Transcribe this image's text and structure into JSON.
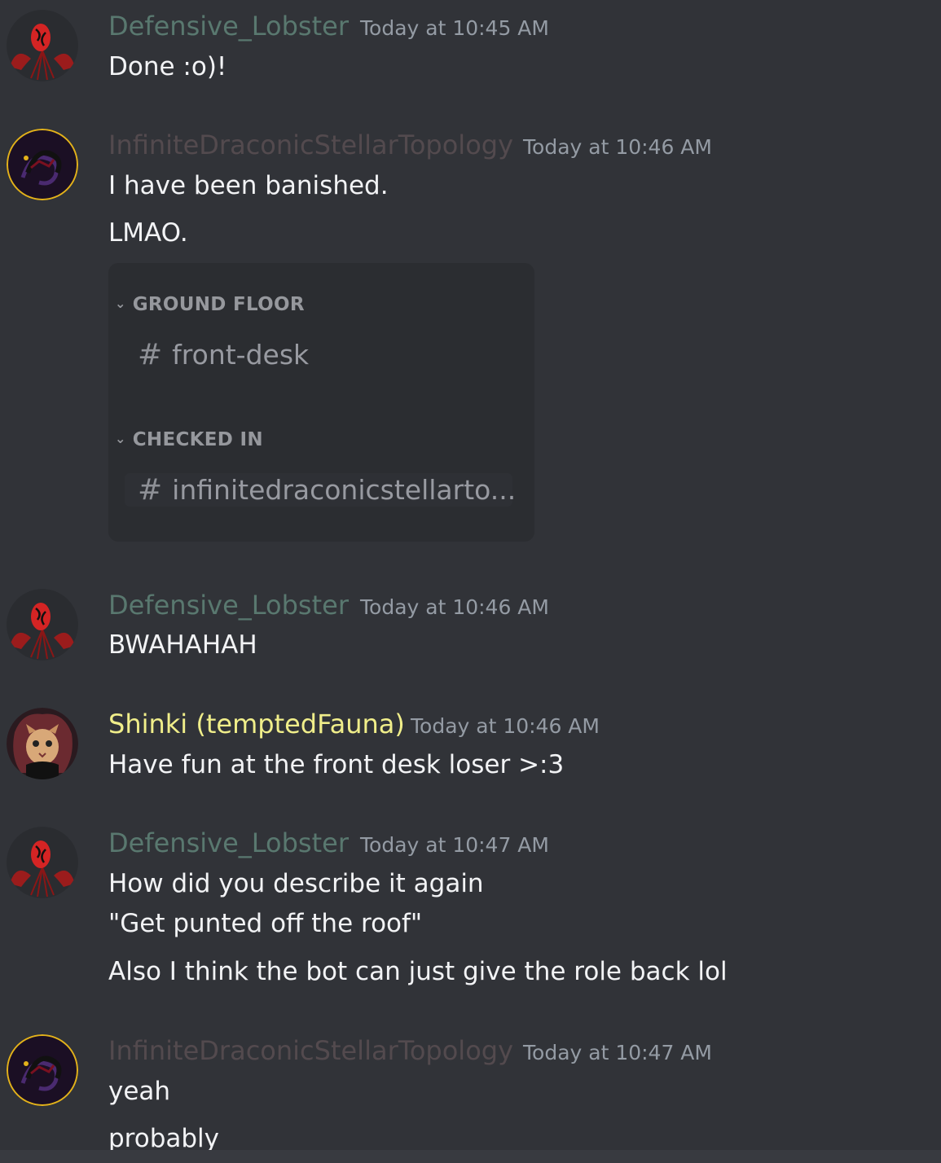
{
  "messages": [
    {
      "author": "Defensive_Lobster",
      "author_color": "#59786f",
      "time": "Today at 10:45 AM",
      "lines": [
        "Done :o)!"
      ]
    },
    {
      "author": "InfiniteDraconicStellarTopology",
      "author_color": "#534a4e",
      "time": "Today at 10:46 AM",
      "lines": [
        "I have been banished.",
        "LMAO."
      ]
    },
    {
      "author": "Defensive_Lobster",
      "author_color": "#59786f",
      "time": "Today at 10:46 AM",
      "lines": [
        "BWAHAHAH"
      ]
    },
    {
      "author": "Shinki (temptedFauna)",
      "author_color": "#f0ee8a",
      "time": "Today at 10:46 AM",
      "lines": [
        "Have fun at the front desk loser >:3"
      ]
    },
    {
      "author": "Defensive_Lobster",
      "author_color": "#59786f",
      "time": "Today at 10:47 AM",
      "lines": [
        "How did you describe it again",
        "\"Get punted off the roof\"",
        "Also I think the bot can just give the role back lol"
      ]
    },
    {
      "author": "InfiniteDraconicStellarTopology",
      "author_color": "#534a4e",
      "time": "Today at 10:47 AM",
      "lines": [
        "yeah",
        "probably"
      ]
    }
  ],
  "embed": {
    "category1": "GROUND FLOOR",
    "channel1": "front-desk",
    "category2": "CHECKED IN",
    "channel2": "infinitedraconicstellarto...",
    "chevron_icon": "chevron-down-icon",
    "hash_icon": "hash-icon",
    "hash_glyph": "#"
  }
}
